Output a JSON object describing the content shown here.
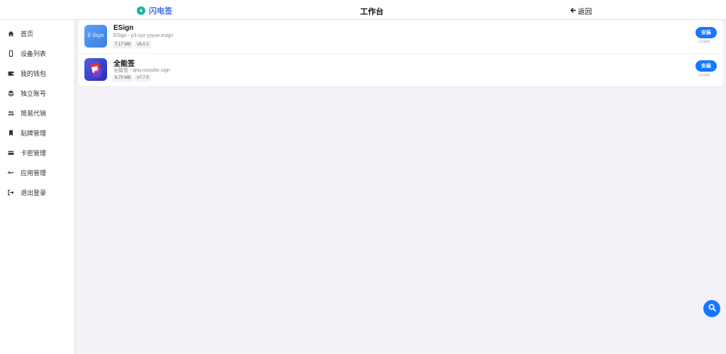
{
  "header": {
    "brand_name": "闪电签",
    "title": "工作台",
    "back_label": "返回",
    "brand_icon": "lightning-icon",
    "brand_color": "#3f6ee8"
  },
  "sidebar": {
    "items": [
      {
        "label": "首页",
        "icon": "home-icon"
      },
      {
        "label": "设备列表",
        "icon": "phone-icon"
      },
      {
        "label": "我的钱包",
        "icon": "wallet-icon"
      },
      {
        "label": "独立账号",
        "icon": "layers-icon"
      },
      {
        "label": "简易代销",
        "icon": "users-icon"
      },
      {
        "label": "贴牌管理",
        "icon": "bookmark-icon"
      },
      {
        "label": "卡密管理",
        "icon": "card-icon"
      },
      {
        "label": "应用管理",
        "icon": "signature-icon"
      },
      {
        "label": "退出登录",
        "icon": "logout-icon"
      }
    ]
  },
  "apps": [
    {
      "name": "ESign",
      "subtitle": "ESign - p3.xyz.yyyue.esign",
      "size": "7.17 MB",
      "version": "v5.0.2",
      "icon_text": "E·Sign",
      "install_label": "安装",
      "install_note": "点击安装"
    },
    {
      "name": "全能签",
      "subtitle": "全能签 - qnq.nuosike.sign",
      "size": "6.75 MB",
      "version": "v7.7.0",
      "icon_text": "",
      "install_label": "安装",
      "install_note": "点击安装"
    }
  ],
  "colors": {
    "accent": "#1677ff",
    "background": "#f1f1f6"
  }
}
